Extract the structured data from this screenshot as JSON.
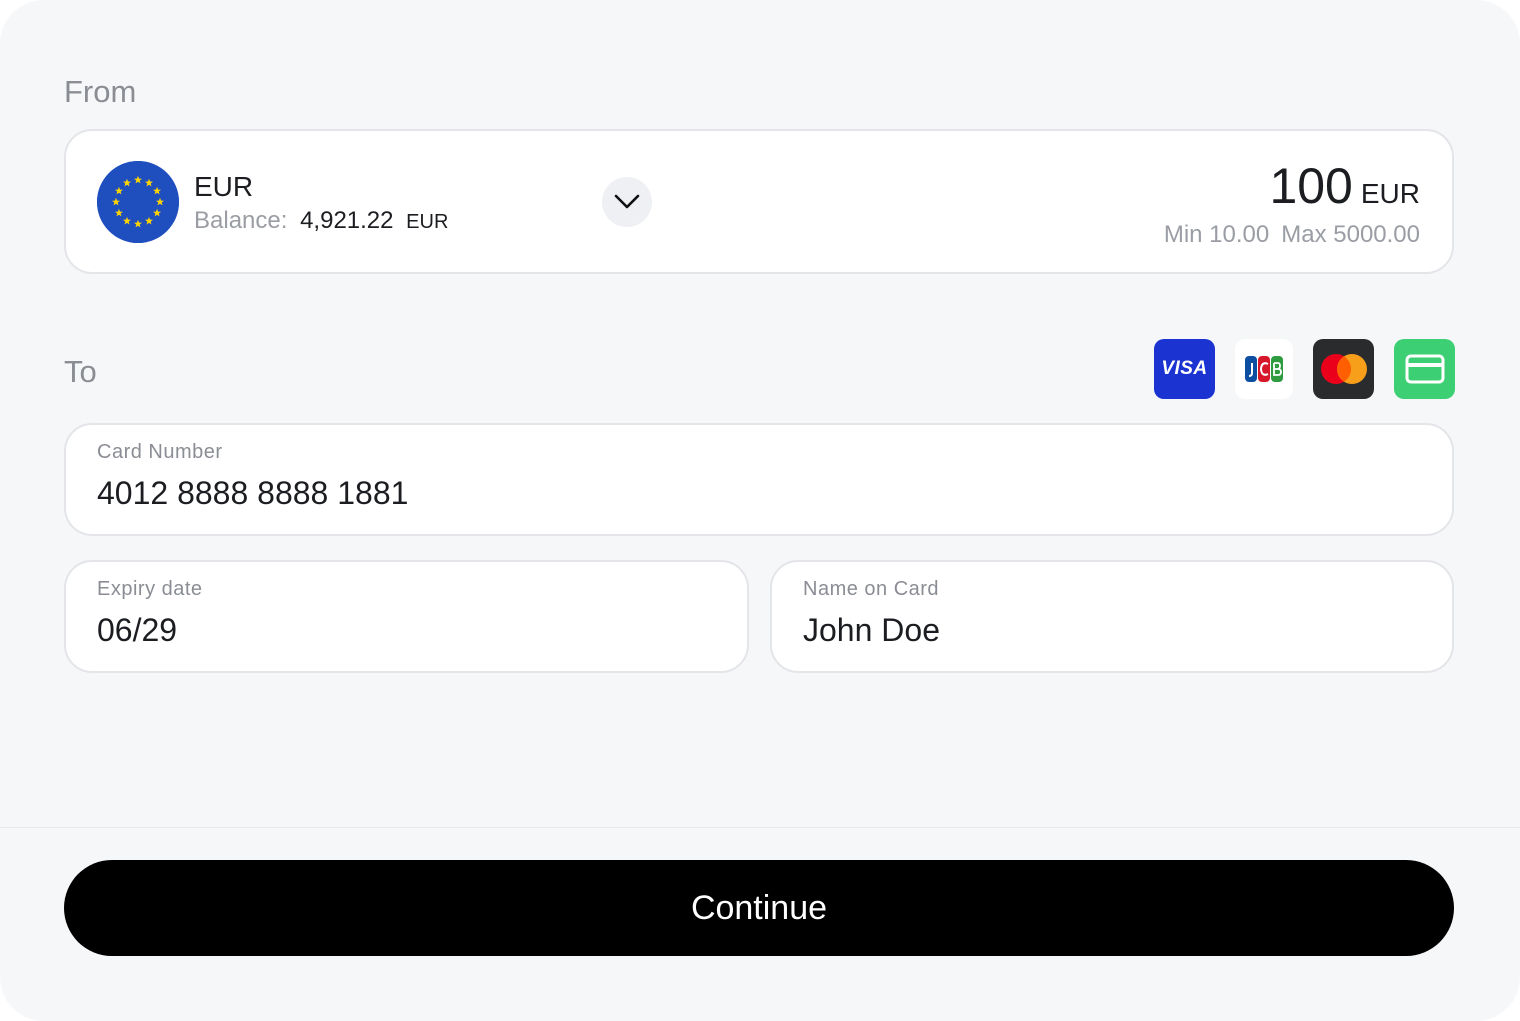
{
  "from": {
    "label": "From",
    "currency_code": "EUR",
    "flag_icon": "eu-flag-icon",
    "balance_label": "Balance:",
    "balance_value": "4,921.22",
    "balance_currency": "EUR",
    "amount_value": "100",
    "amount_currency": "EUR",
    "min_limit": "Min 10.00",
    "max_limit": "Max 5000.00"
  },
  "to": {
    "label": "To",
    "brands": [
      "visa-icon",
      "jcb-icon",
      "mastercard-icon",
      "credit-card-icon"
    ],
    "visa_text": "VISA",
    "card_number_label": "Card Number",
    "card_number_value": "4012 8888 8888 1881",
    "expiry_label": "Expiry date",
    "expiry_value": "06/29",
    "name_label": "Name on Card",
    "name_value": "John Doe"
  },
  "footer": {
    "continue_label": "Continue"
  },
  "colors": {
    "panel_bg": "#f6f7f9",
    "visa_blue": "#1a33d1",
    "mastercard_red": "#eb001b",
    "mastercard_orange": "#f79e1b",
    "generic_card_green": "#3ccf73",
    "eu_blue": "#1f4fbf",
    "eu_star": "#ffd500",
    "button_bg": "#000000"
  }
}
